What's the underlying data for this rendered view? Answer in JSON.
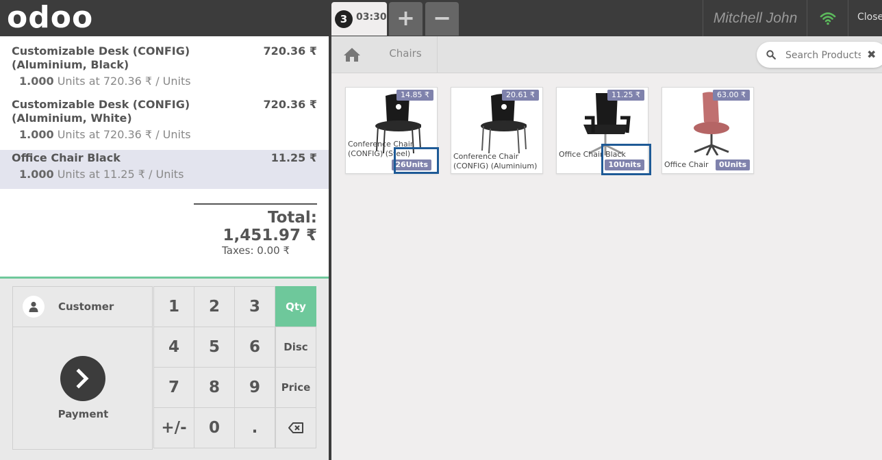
{
  "header": {
    "logo": "odoo",
    "order_number": "3",
    "order_time": "03:30",
    "add_label": "+",
    "remove_label": "−",
    "user_name": "Mitchell John",
    "close_label": "Close"
  },
  "order": {
    "lines": [
      {
        "name": "Customizable Desk (CONFIG) (Aluminium, Black)",
        "price": "720.36 ₹",
        "qty": "1.000",
        "detail": "Units at 720.36 ₹ / Units"
      },
      {
        "name": "Customizable Desk (CONFIG) (Aluminium, White)",
        "price": "720.36 ₹",
        "qty": "1.000",
        "detail": "Units at 720.36 ₹ / Units"
      },
      {
        "name": "Office Chair Black",
        "price": "11.25 ₹",
        "qty": "1.000",
        "detail": "Units at 11.25 ₹ / Units"
      }
    ],
    "total": "Total: 1,451.97 ₹",
    "taxes": "Taxes: 0.00 ₹"
  },
  "controls": {
    "customer_label": "Customer",
    "payment_label": "Payment",
    "keys": [
      "1",
      "2",
      "3",
      "4",
      "5",
      "6",
      "7",
      "8",
      "9",
      "+/-",
      "0",
      "."
    ],
    "modes": [
      "Qty",
      "Disc",
      "Price"
    ]
  },
  "category": {
    "current": "Chairs"
  },
  "search": {
    "placeholder": "Search Products"
  },
  "products": [
    {
      "name": "Conference Chair (CONFIG) (Steel)",
      "price": "14.85 ₹",
      "stock": "26Units"
    },
    {
      "name": "Conference Chair (CONFIG) (Aluminium)",
      "price": "20.61 ₹",
      "stock": ""
    },
    {
      "name": "Office Chair Black",
      "price": "11.25 ₹",
      "stock": "10Units"
    },
    {
      "name": "Office Chair",
      "price": "63.00 ₹",
      "stock": "0Units"
    }
  ],
  "colors": {
    "topbar": "#3c3c3c",
    "accent": "#6ec89b",
    "tag": "#7f82ac",
    "highlight": "#1e5a96"
  }
}
